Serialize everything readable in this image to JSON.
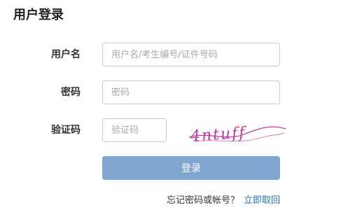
{
  "page": {
    "title": "用户登录"
  },
  "form": {
    "username": {
      "label": "用户名",
      "placeholder": "用户名/考生编号/证件号码",
      "value": ""
    },
    "password": {
      "label": "密码",
      "placeholder": "密码",
      "value": ""
    },
    "captcha": {
      "label": "验证码",
      "placeholder": "验证码",
      "value": "",
      "image_text": "4ntuff"
    },
    "submit_label": "登录"
  },
  "footer": {
    "forgot_text": "忘记密码或帐号？",
    "retrieve_link": "立即取回"
  },
  "colors": {
    "button_bg": "#7ea6cf",
    "link": "#2a6fb5",
    "captcha_ink": "#c0399f"
  }
}
